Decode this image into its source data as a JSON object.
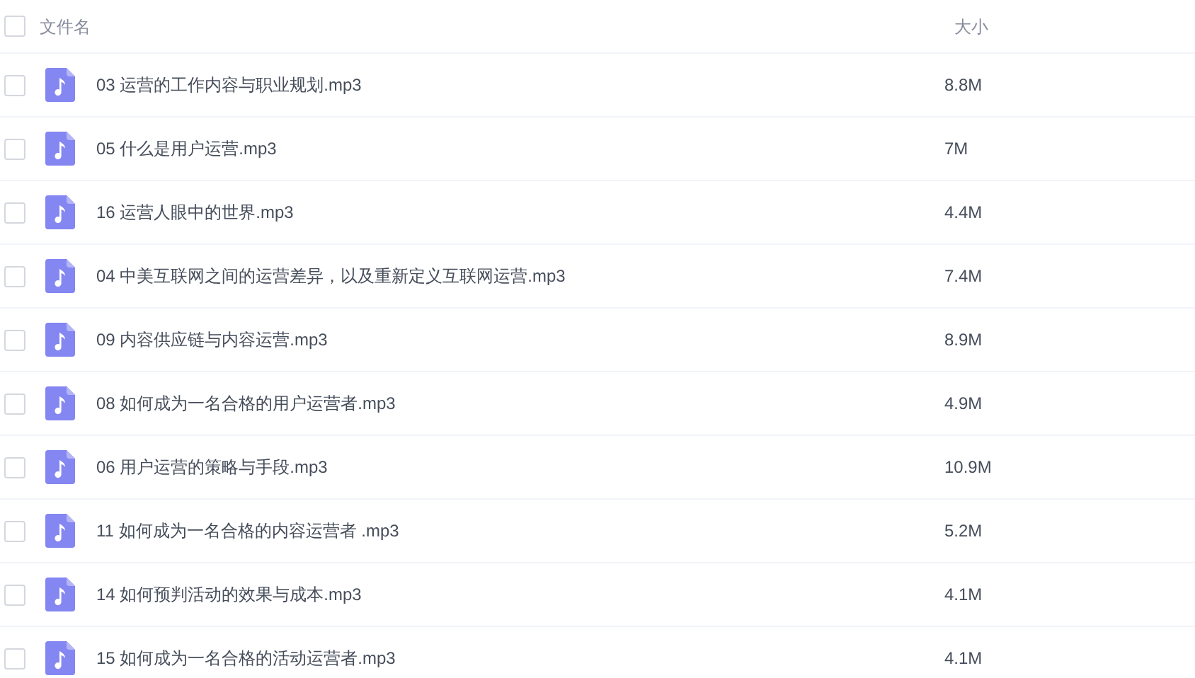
{
  "header": {
    "checked": false,
    "name_label": "文件名",
    "size_label": "大小"
  },
  "files": [
    {
      "name": "03 运营的工作内容与职业规划.mp3",
      "size": "8.8M",
      "checked": false
    },
    {
      "name": "05 什么是用户运营.mp3",
      "size": "7M",
      "checked": false
    },
    {
      "name": "16 运营人眼中的世界.mp3",
      "size": "4.4M",
      "checked": false
    },
    {
      "name": "04 中美互联网之间的运营差异，以及重新定义互联网运营.mp3",
      "size": "7.4M",
      "checked": false
    },
    {
      "name": "09 内容供应链与内容运营.mp3",
      "size": "8.9M",
      "checked": false
    },
    {
      "name": "08 如何成为一名合格的用户运营者.mp3",
      "size": "4.9M",
      "checked": false
    },
    {
      "name": "06 用户运营的策略与手段.mp3",
      "size": "10.9M",
      "checked": false
    },
    {
      "name": "11 如何成为一名合格的内容运营者 .mp3",
      "size": "5.2M",
      "checked": false
    },
    {
      "name": "14 如何预判活动的效果与成本.mp3",
      "size": "4.1M",
      "checked": false
    },
    {
      "name": "15 如何成为一名合格的活动运营者.mp3",
      "size": "4.1M",
      "checked": false
    }
  ]
}
